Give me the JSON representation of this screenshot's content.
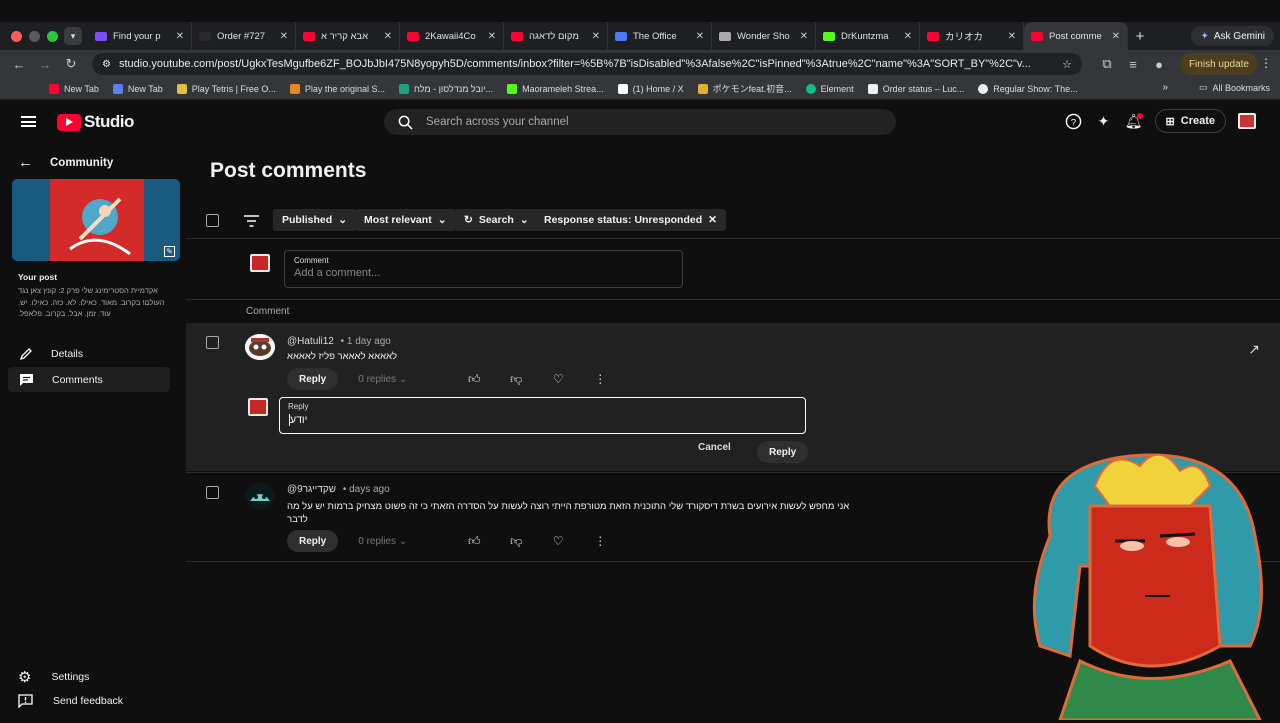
{
  "browser": {
    "tabs": [
      {
        "title": "Find your p",
        "color": "#7b4dff"
      },
      {
        "title": "Order #727",
        "color": "#2a2a2a"
      },
      {
        "title": "אבא קריר א",
        "color": "#ff0033"
      },
      {
        "title": "2Kawaii4Co",
        "color": "#ff0033"
      },
      {
        "title": "מקום לדאגה",
        "color": "#ff0033"
      },
      {
        "title": "The Office",
        "color": "#4a7bf7"
      },
      {
        "title": "Wonder Sho",
        "color": "#aaaaaa"
      },
      {
        "title": "DrKuntzma",
        "color": "#53fc18"
      },
      {
        "title": "カリオカ",
        "color": "#ff0033"
      },
      {
        "title": "Post comme",
        "color": "#ff0033"
      }
    ],
    "ask_gemini": "Ask Gemini",
    "url": "studio.youtube.com/post/UgkxTesMgufbe6ZF_BOJbJbI475N8yopyh5D/comments/inbox?filter=%5B%7B\"isDisabled\"%3Afalse%2C\"isPinned\"%3Atrue%2C\"name\"%3A\"SORT_BY\"%2C\"v...",
    "finish_update": "Finish update",
    "bookmarks": [
      {
        "label": "New Tab",
        "color": "#ff0033"
      },
      {
        "label": "New Tab",
        "color": "#5a7fff"
      },
      {
        "label": "Play Tetris | Free O...",
        "color": "#e0c040"
      },
      {
        "label": "Play the original S...",
        "color": "#e08a20"
      },
      {
        "label": "יובל מנדלסון - מלח...",
        "color": "#20a080"
      },
      {
        "label": "Maorameleh Strea...",
        "color": "#53fc18"
      },
      {
        "label": "(1) Home / X",
        "color": "#ffffff"
      },
      {
        "label": "ポケモンfeat.初音...",
        "color": "#e0b030"
      },
      {
        "label": "Element",
        "color": "#0dbd8b"
      },
      {
        "label": "Order status – Luc...",
        "color": "#eeeeee"
      },
      {
        "label": "Regular Show: The...",
        "color": "#eeeeee"
      }
    ],
    "all_bookmarks": "All Bookmarks"
  },
  "header": {
    "logo_text": "Studio",
    "search_placeholder": "Search across your channel",
    "create_label": "Create"
  },
  "sidebar": {
    "section_title": "Community",
    "your_post_label": "Your post",
    "post_text": "אקדמיית הסטרימינג שלי פרק 2: קונץ צאן נגד העולם! בקרוב. מאוד. כאילו. לא. כזה. כאילו. יש. עוד. זמן. אבל. בקרוב. פלאפל.",
    "items": [
      {
        "label": "Details",
        "icon": "pencil-icon"
      },
      {
        "label": "Comments",
        "icon": "comment-icon"
      }
    ],
    "bottom": [
      {
        "label": "Settings",
        "icon": "gear-icon"
      },
      {
        "label": "Send feedback",
        "icon": "feedback-icon"
      }
    ]
  },
  "main": {
    "title": "Post comments",
    "filters": {
      "published": "Published",
      "relevance": "Most relevant",
      "search": "Search",
      "response_status": "Response status: Unresponded"
    },
    "compose": {
      "label": "Comment",
      "placeholder": "Add a comment..."
    },
    "column_header": "Comment",
    "comments": [
      {
        "author": "@Hatuli12",
        "time": "1 day ago",
        "text": "לאאאא לאאאר פליז לאאאא",
        "reply_label": "Reply",
        "replies": "0 replies"
      },
      {
        "author": "@9שקדייגר",
        "time": "days ago",
        "text": "אני מחפש לעשות אירועים בשרת דיסקורד שלי התוכנית הזאת מטורפת הייתי רוצה לעשות על הסדרה הזאתי כי זה פשוט מצחיק ברמות יש על מה לדבר",
        "reply_label": "Reply",
        "replies": "0 replies"
      }
    ],
    "reply_box": {
      "label": "Reply",
      "value": "יודע",
      "cancel": "Cancel",
      "submit": "Reply"
    }
  },
  "colors": {
    "accent": "#ff0033",
    "background": "#0f0f0f",
    "row_highlight": "#212121"
  }
}
